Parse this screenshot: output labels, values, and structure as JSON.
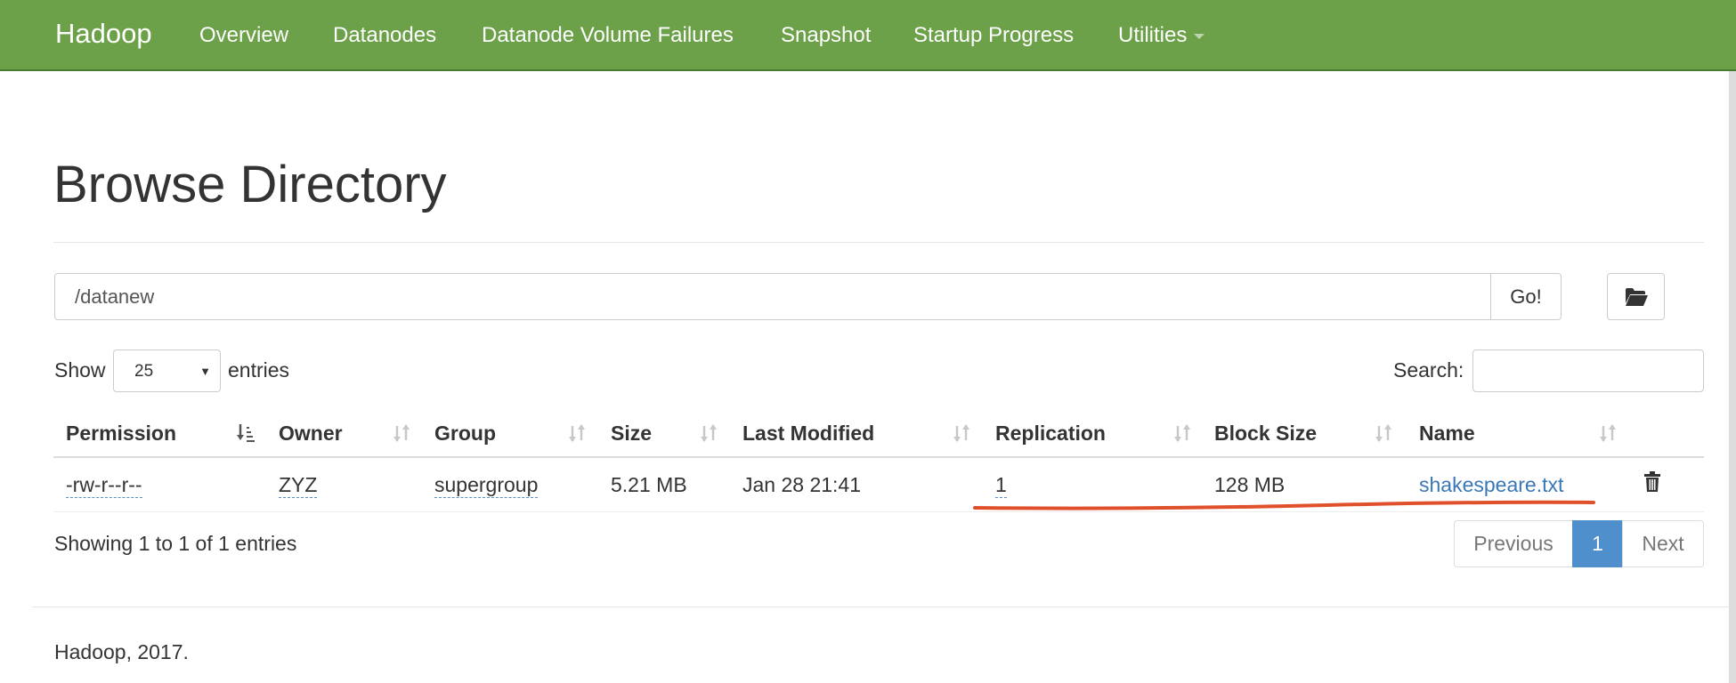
{
  "navbar": {
    "brand": "Hadoop",
    "items": [
      "Overview",
      "Datanodes",
      "Datanode Volume Failures",
      "Snapshot",
      "Startup Progress",
      "Utilities"
    ]
  },
  "page": {
    "title": "Browse Directory",
    "path": "/datanew",
    "go_label": "Go!"
  },
  "controls": {
    "show_label": "Show",
    "page_length": "25",
    "entries_label": "entries",
    "search_label": "Search:",
    "search_value": ""
  },
  "table": {
    "columns": [
      "Permission",
      "Owner",
      "Group",
      "Size",
      "Last Modified",
      "Replication",
      "Block Size",
      "Name"
    ],
    "rows": [
      {
        "permission": "-rw-r--r--",
        "owner": "ZYZ",
        "group": "supergroup",
        "size": "5.21 MB",
        "last_modified": "Jan 28 21:41",
        "replication": "1",
        "block_size": "128 MB",
        "name": "shakespeare.txt"
      }
    ],
    "info": "Showing 1 to 1 of 1 entries"
  },
  "pagination": {
    "previous": "Previous",
    "current": "1",
    "next": "Next"
  },
  "footer": {
    "text": "Hadoop, 2017."
  },
  "colors": {
    "navbar": "#6ca14a",
    "link": "#3a77b8",
    "active_page": "#4f8fcb",
    "annotation": "#e0502a"
  }
}
